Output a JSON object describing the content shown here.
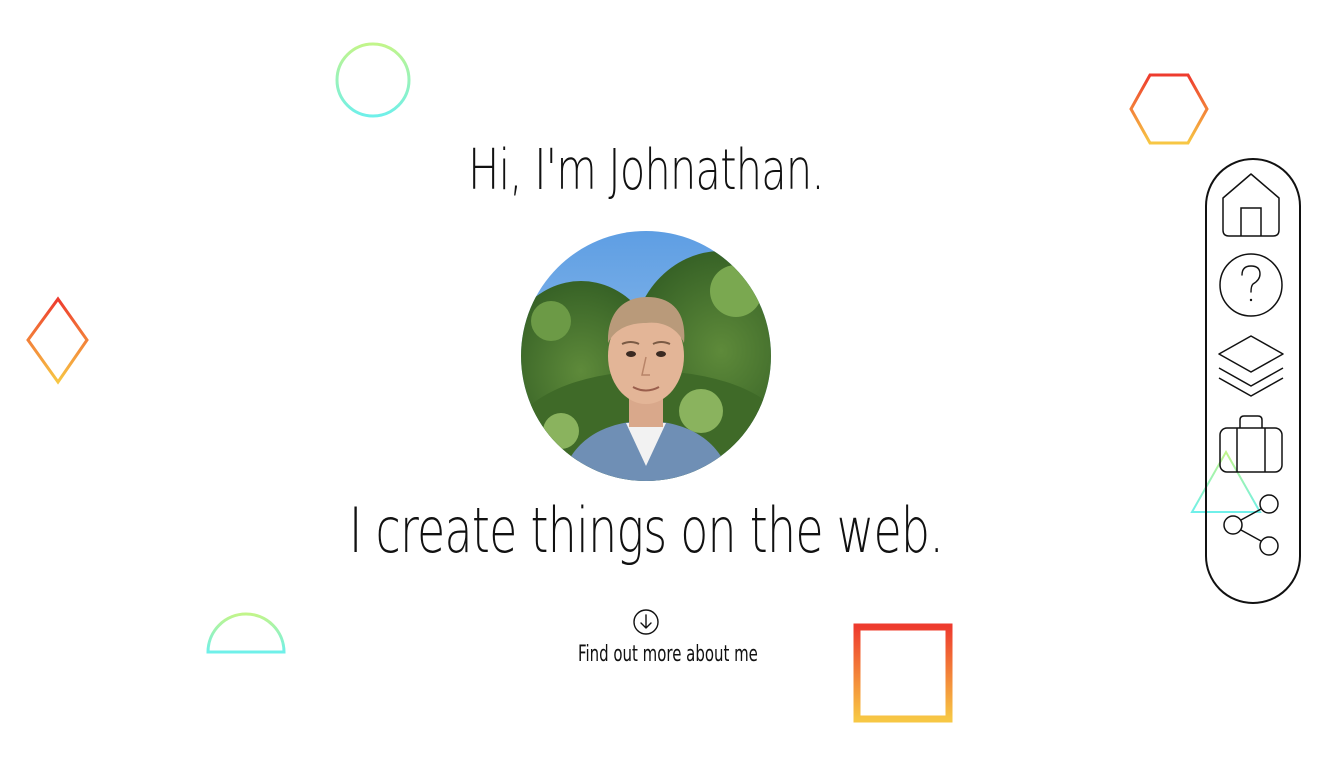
{
  "hero": {
    "title": "Hi, I'm Johnathan.",
    "tagline": "I create things on the web.",
    "cta_label": "Find out more about me"
  },
  "icons": {
    "cta": "arrow-down-circle-icon",
    "nav": [
      "home-icon",
      "question-icon",
      "layers-icon",
      "briefcase-icon",
      "share-icon"
    ]
  },
  "colors": {
    "text": "#111111",
    "warm_gradient": [
      "#ee3b2e",
      "#f7c744"
    ],
    "cool_gradient": [
      "#c2f58a",
      "#6ff0ea"
    ]
  }
}
